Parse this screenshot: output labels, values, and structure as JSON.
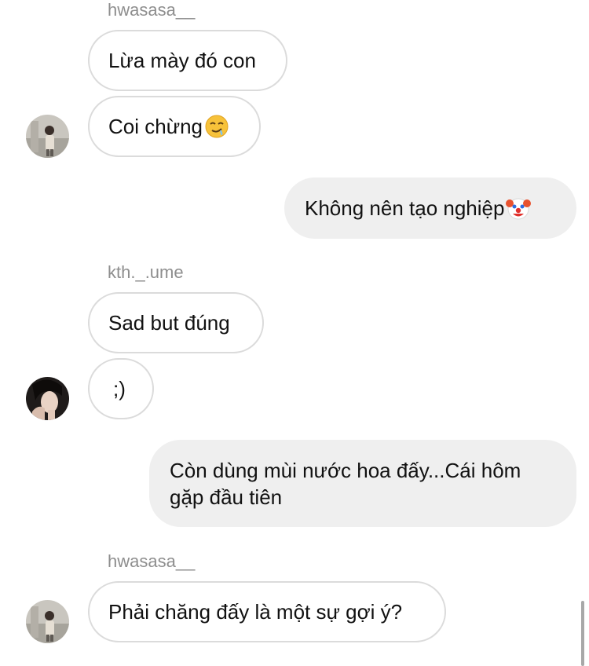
{
  "messages": [
    {
      "username": "hwasasa__"
    },
    {
      "text": "Lừa mày đó con"
    },
    {
      "text": "Coi chừng",
      "emoji": "drooling-face-icon"
    },
    {
      "text": "Không nên tạo nghiệp",
      "emoji": "clown-face-icon"
    },
    {
      "username": "kth._.ume"
    },
    {
      "text": "Sad but đúng"
    },
    {
      "text": ";)"
    },
    {
      "text_line1": "Còn dùng mùi nước hoa đấy...Cái hôm",
      "text_line2": "gặp đầu tiên"
    },
    {
      "username": "hwasasa__"
    },
    {
      "text": "Phải chăng đấy là một sự gợi ý?"
    }
  ],
  "colors": {
    "incoming_border": "#dbdbdb",
    "outgoing_bg": "#efefef",
    "username": "#8e8e8e"
  }
}
